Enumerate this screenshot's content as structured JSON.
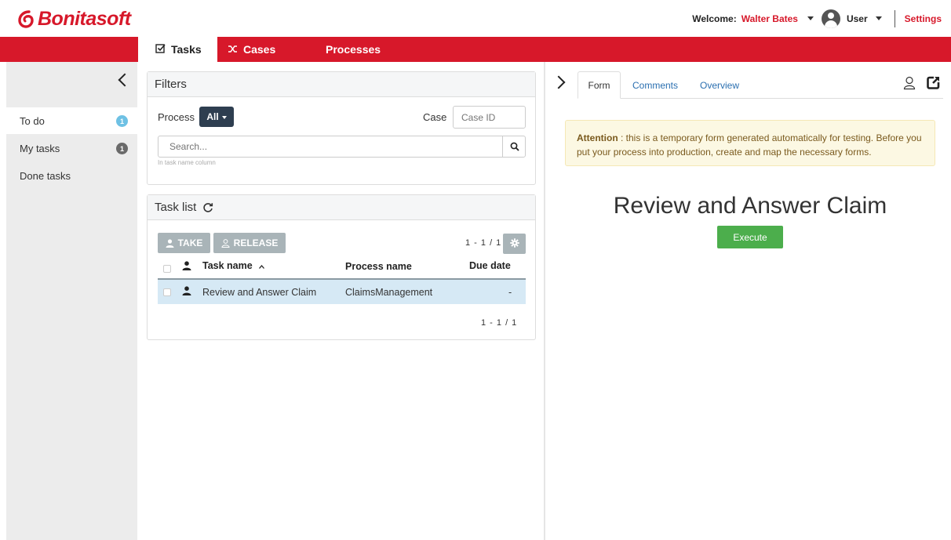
{
  "app": {
    "brand": "Bonitasoft",
    "brand_color": "#d7182a"
  },
  "header": {
    "welcome_label": "Welcome:",
    "user_name": "Walter Bates",
    "role": "User",
    "settings_label": "Settings"
  },
  "nav": {
    "tabs": [
      {
        "label": "Tasks",
        "icon": "check-square-icon",
        "active": true
      },
      {
        "label": "Cases",
        "icon": "shuffle-icon",
        "active": false
      },
      {
        "label": "Processes",
        "icon": "",
        "active": false
      }
    ]
  },
  "sidebar": {
    "items": [
      {
        "label": "To do",
        "badge": "1",
        "active": true
      },
      {
        "label": "My tasks",
        "badge": "1",
        "active": false
      },
      {
        "label": "Done tasks",
        "badge": "",
        "active": false
      }
    ]
  },
  "filters": {
    "title": "Filters",
    "process_label": "Process",
    "process_value": "All",
    "case_label": "Case",
    "case_placeholder": "Case ID",
    "search_placeholder": "Search...",
    "search_hint": "In task name column"
  },
  "task_list": {
    "title": "Task list",
    "take_label": "TAKE",
    "release_label": "RELEASE",
    "pager_top": "1 - 1 / 1",
    "pager_bottom": "1 - 1 / 1",
    "columns": [
      "Task name",
      "Process name",
      "Due date"
    ],
    "rows": [
      {
        "task_name": "Review and Answer Claim",
        "process_name": "ClaimsManagement",
        "due_date": "-"
      }
    ]
  },
  "right_pane": {
    "tabs": [
      {
        "label": "Form",
        "active": true
      },
      {
        "label": "Comments",
        "active": false
      },
      {
        "label": "Overview",
        "active": false
      }
    ],
    "attention_label": "Attention",
    "attention_text": " : this is a temporary form generated automatically for testing. Before you put your process into production, create and map the necessary forms.",
    "form_title": "Review and Answer Claim",
    "execute_label": "Execute"
  },
  "colors": {
    "nav_red": "#d7182a",
    "dark_button": "#2e3e50",
    "execute_green": "#4cae4c",
    "selected_row": "#d6e9f5",
    "badge_blue": "#6ec1e4"
  }
}
